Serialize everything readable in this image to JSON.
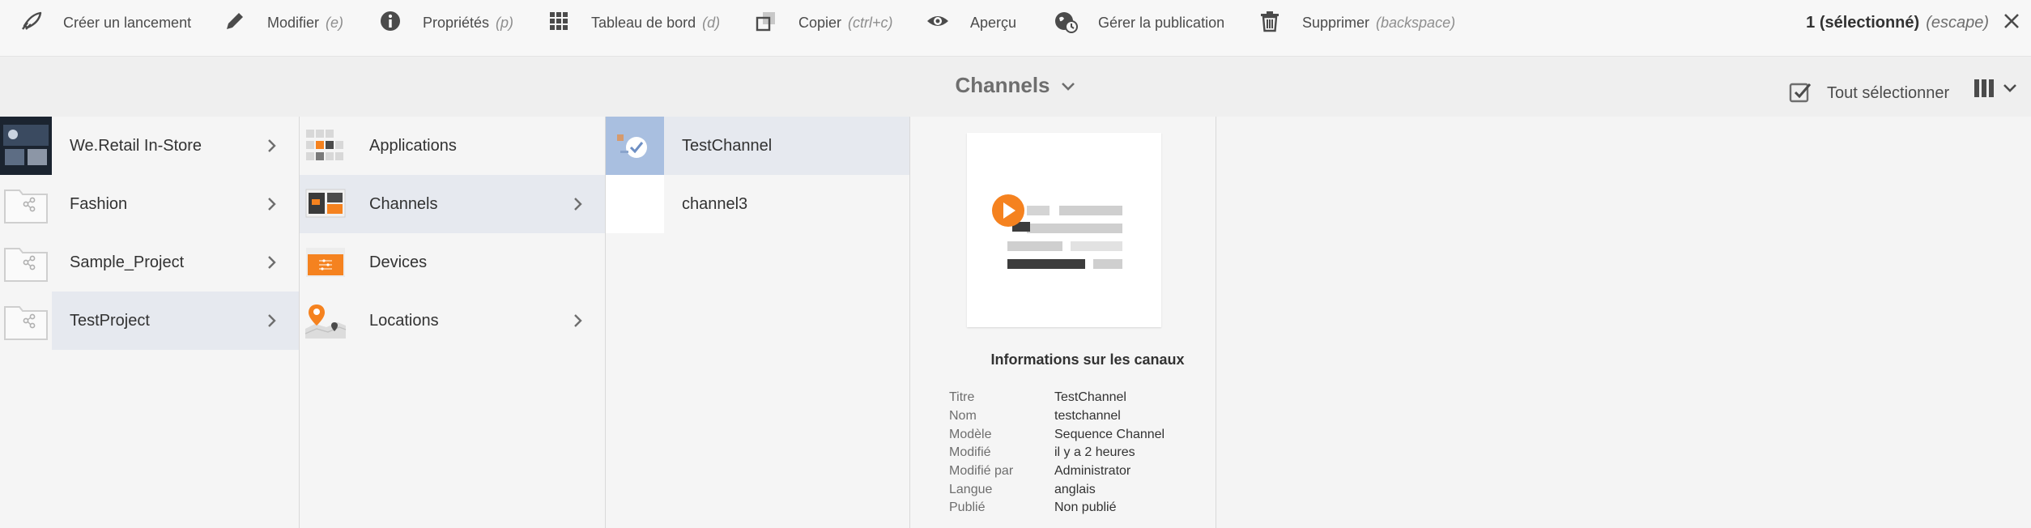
{
  "actionbar": {
    "actions": [
      {
        "label": "Créer un lancement",
        "shortcut": "",
        "icon": "launch-icon"
      },
      {
        "label": "Modifier",
        "shortcut": "(e)",
        "icon": "pencil-icon"
      },
      {
        "label": "Propriétés",
        "shortcut": "(p)",
        "icon": "info-icon"
      },
      {
        "label": "Tableau de bord",
        "shortcut": "(d)",
        "icon": "dashboard-grid-icon"
      },
      {
        "label": "Copier",
        "shortcut": "(ctrl+c)",
        "icon": "copy-icon"
      },
      {
        "label": "Aperçu",
        "shortcut": "",
        "icon": "eye-icon"
      },
      {
        "label": "Gérer la publication",
        "shortcut": "",
        "icon": "publication-icon"
      },
      {
        "label": "Supprimer",
        "shortcut": "(backspace)",
        "icon": "trash-icon"
      }
    ],
    "selection": {
      "count_label": "1 (sélectionné)",
      "escape_hint": "(escape)"
    }
  },
  "titlebar": {
    "title": "Channels",
    "select_all": "Tout sélectionner"
  },
  "columns": {
    "col1": [
      {
        "name": "We.Retail In-Store"
      },
      {
        "name": "Fashion"
      },
      {
        "name": "Sample_Project"
      },
      {
        "name": "TestProject"
      }
    ],
    "col2": [
      {
        "name": "Applications"
      },
      {
        "name": "Channels"
      },
      {
        "name": "Devices"
      },
      {
        "name": "Locations"
      }
    ],
    "col3": [
      {
        "name": "TestChannel"
      },
      {
        "name": "channel3"
      }
    ]
  },
  "detail": {
    "heading": "Informations sur les canaux",
    "properties": [
      {
        "key": "Titre",
        "value": "TestChannel"
      },
      {
        "key": "Nom",
        "value": "testchannel"
      },
      {
        "key": "Modèle",
        "value": "Sequence Channel"
      },
      {
        "key": "Modifié",
        "value": "il y a 2 heures"
      },
      {
        "key": "Modifié par",
        "value": "Administrator"
      },
      {
        "key": "Langue",
        "value": "anglais"
      },
      {
        "key": "Publié",
        "value": "Non publié"
      }
    ]
  },
  "colors": {
    "accent": "#f5821f",
    "selected_row": "#e6e9ef",
    "text": "#323232"
  }
}
